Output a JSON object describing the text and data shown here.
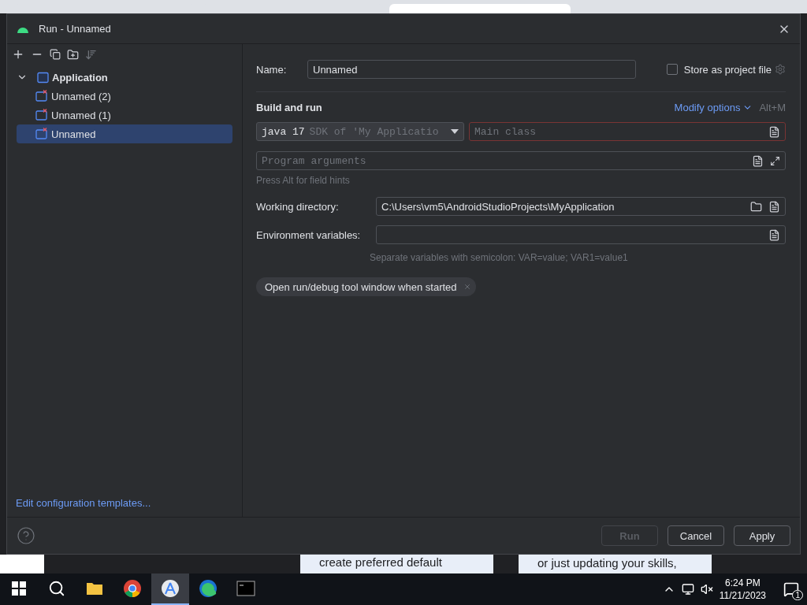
{
  "window": {
    "title": "Run - Unnamed"
  },
  "tree": {
    "label": "Application",
    "expanded": true,
    "children": [
      {
        "label": "Unnamed (2)",
        "selected": false
      },
      {
        "label": "Unnamed (1)",
        "selected": false
      },
      {
        "label": "Unnamed",
        "selected": true
      }
    ]
  },
  "templates_link": "Edit configuration templates...",
  "form": {
    "name_label": "Name:",
    "name_value": "Unnamed",
    "store_as_project_file": {
      "label": "Store as project file",
      "checked": false
    },
    "section_title": "Build and run",
    "modify_options": "Modify options",
    "modify_shortcut": "Alt+M",
    "jdk": {
      "value": "java 17",
      "hint": "SDK of 'My Applicatio"
    },
    "main_class": {
      "placeholder": "Main class",
      "error": true
    },
    "program_arguments": {
      "placeholder": "Program arguments"
    },
    "field_hints": "Press Alt for field hints",
    "working_directory": {
      "label": "Working directory:",
      "value": "C:\\Users\\vm5\\AndroidStudioProjects\\MyApplication"
    },
    "environment_variables": {
      "label": "Environment variables:",
      "hint": "Separate variables with semicolon: VAR=value; VAR1=value1"
    },
    "options": [
      {
        "label": "Open run/debug tool window when started"
      }
    ]
  },
  "buttons": [
    {
      "label": "Run",
      "disabled": true
    },
    {
      "label": "Cancel",
      "disabled": false
    },
    {
      "label": "Apply",
      "disabled": false
    }
  ],
  "background_page": {
    "texts": [
      "create preferred default",
      "or just updating your skills,"
    ]
  },
  "taskbar": {
    "apps": [
      {
        "kind": "folder",
        "active": false
      },
      {
        "kind": "chrome",
        "active": false
      },
      {
        "kind": "studio",
        "active": true
      },
      {
        "kind": "edge",
        "active": false
      },
      {
        "kind": "terminal",
        "active": false
      }
    ],
    "time": "6:24 PM",
    "date": "11/21/2023",
    "notifications": "1"
  }
}
